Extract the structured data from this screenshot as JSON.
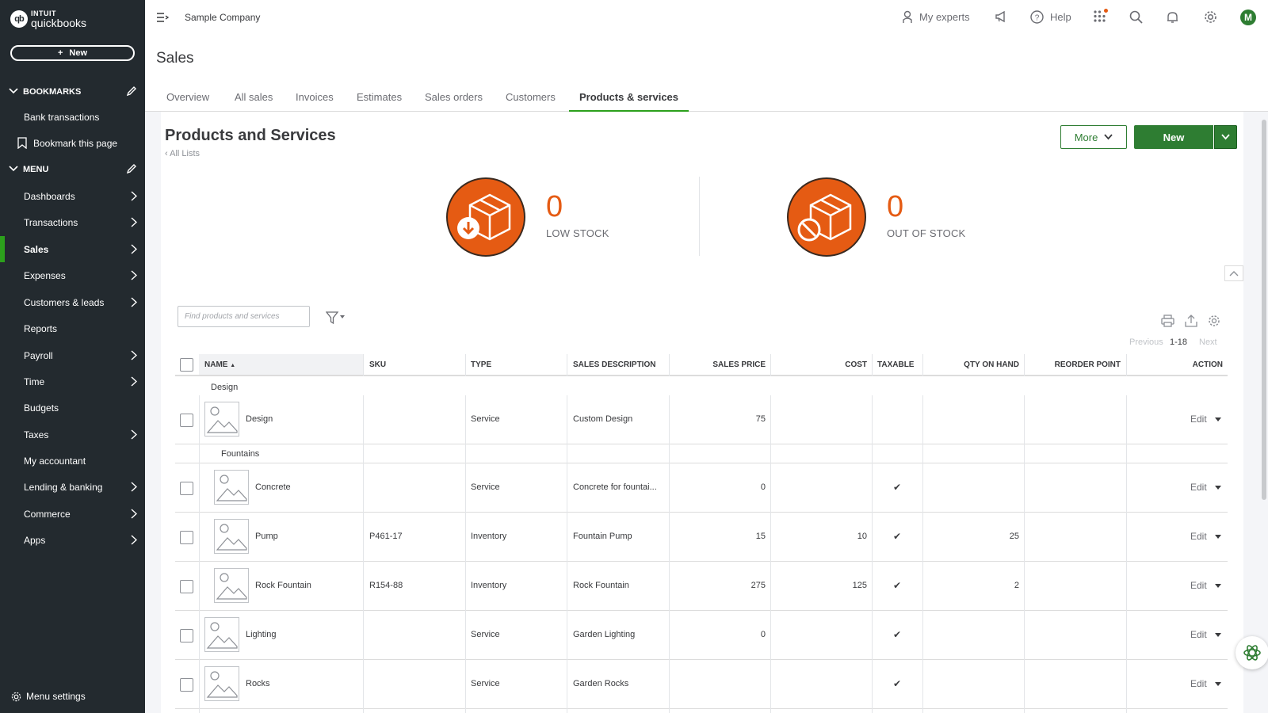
{
  "sidebar": {
    "logo_top": "INTUIT",
    "logo_bottom": "quickbooks",
    "logo_badge": "qb",
    "new_label": "New",
    "bookmarks_label": "BOOKMARKS",
    "bookmarks": [
      {
        "label": "Bank transactions"
      },
      {
        "label": "Bookmark this page"
      }
    ],
    "menu_label": "MENU",
    "items": [
      {
        "label": "Dashboards"
      },
      {
        "label": "Transactions"
      },
      {
        "label": "Sales"
      },
      {
        "label": "Expenses"
      },
      {
        "label": "Customers & leads"
      },
      {
        "label": "Reports"
      },
      {
        "label": "Payroll"
      },
      {
        "label": "Time"
      },
      {
        "label": "Budgets"
      },
      {
        "label": "Taxes"
      },
      {
        "label": "My accountant"
      },
      {
        "label": "Lending & banking"
      },
      {
        "label": "Commerce"
      },
      {
        "label": "Apps"
      }
    ],
    "active_item": "Sales",
    "menu_settings": "Menu settings"
  },
  "topbar": {
    "company": "Sample Company",
    "my_experts": "My experts",
    "help": "Help",
    "avatar_initial": "M"
  },
  "page": {
    "title": "Sales",
    "tabs": [
      {
        "label": "Overview"
      },
      {
        "label": "All sales"
      },
      {
        "label": "Invoices"
      },
      {
        "label": "Estimates"
      },
      {
        "label": "Sales orders"
      },
      {
        "label": "Customers"
      },
      {
        "label": "Products & services"
      }
    ],
    "active_tab": "Products & services"
  },
  "products": {
    "title": "Products and Services",
    "back_link": "All Lists",
    "more_label": "More",
    "new_label": "New",
    "low_stock": {
      "count": "0",
      "label": "LOW STOCK"
    },
    "out_of_stock": {
      "count": "0",
      "label": "OUT OF STOCK"
    },
    "search_placeholder": "Find products and services",
    "pager": {
      "previous": "Previous",
      "range": "1-18",
      "next": "Next"
    },
    "columns": [
      "NAME",
      "SKU",
      "TYPE",
      "SALES DESCRIPTION",
      "SALES PRICE",
      "COST",
      "TAXABLE",
      "QTY ON HAND",
      "REORDER POINT",
      "ACTION"
    ],
    "sort_indicator": "▲",
    "groups": [
      {
        "label": "Design"
      },
      {
        "label": "Fountains"
      }
    ],
    "rows": [
      {
        "name": "Design",
        "sku": "",
        "type": "Service",
        "description": "Custom Design",
        "price": "75",
        "cost": "",
        "taxable": "",
        "qty": "",
        "reorder": "",
        "action": "Edit"
      },
      {
        "name": "Concrete",
        "sku": "",
        "type": "Service",
        "description": "Concrete for fountai...",
        "price": "0",
        "cost": "",
        "taxable": "✔",
        "qty": "",
        "reorder": "",
        "action": "Edit"
      },
      {
        "name": "Pump",
        "sku": "P461-17",
        "type": "Inventory",
        "description": "Fountain Pump",
        "price": "15",
        "cost": "10",
        "taxable": "✔",
        "qty": "25",
        "reorder": "",
        "action": "Edit"
      },
      {
        "name": "Rock Fountain",
        "sku": "R154-88",
        "type": "Inventory",
        "description": "Rock Fountain",
        "price": "275",
        "cost": "125",
        "taxable": "✔",
        "qty": "2",
        "reorder": "",
        "action": "Edit"
      },
      {
        "name": "Lighting",
        "sku": "",
        "type": "Service",
        "description": "Garden Lighting",
        "price": "0",
        "cost": "",
        "taxable": "✔",
        "qty": "",
        "reorder": "",
        "action": "Edit"
      },
      {
        "name": "Rocks",
        "sku": "",
        "type": "Service",
        "description": "Garden Rocks",
        "price": "",
        "cost": "",
        "taxable": "✔",
        "qty": "",
        "reorder": "",
        "action": "Edit"
      }
    ]
  },
  "colors": {
    "sidebar_bg": "#232a2f",
    "brand_green": "#2e7d32",
    "active_green": "#2ca01c",
    "stock_orange": "#e55b13"
  }
}
